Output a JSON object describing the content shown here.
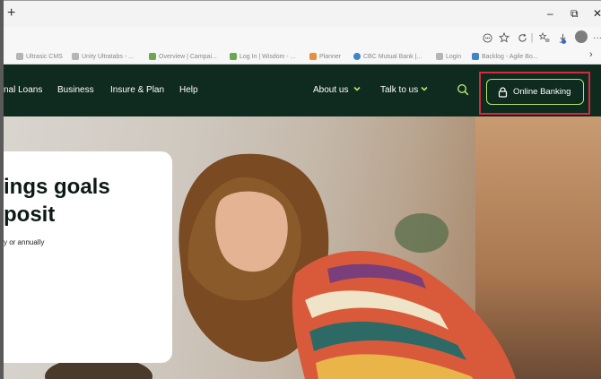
{
  "browser": {
    "new_tab_glyph": "+",
    "window_controls": {
      "minimize": "–",
      "restore": "⧉",
      "close": "✕"
    },
    "toolbar_icons": [
      "reader-icon",
      "favorite-star-icon",
      "refresh-icon",
      "favorites-list-icon",
      "downloads-icon",
      "profile-avatar-icon",
      "more-icon"
    ],
    "bookmarks": [
      {
        "label": "Ultrasic CMS",
        "color": "#9aa0a6"
      },
      {
        "label": "Unity Ultratabs - ...",
        "color": "#9aa0a6"
      },
      {
        "label": "Overview | Campai...",
        "color": "#6aa84f"
      },
      {
        "label": "Log In | Wisdom - ...",
        "color": "#6aa84f"
      },
      {
        "label": "Planner",
        "color": "#e69138"
      },
      {
        "label": "CBC Mutual Bank |...",
        "color": "#3d85c6"
      },
      {
        "label": "Login",
        "color": "#9aa0a6"
      },
      {
        "label": "Backlog - Agile Bo...",
        "color": "#3d85c6"
      }
    ],
    "bookmarks_overflow": "›"
  },
  "nav": {
    "items": [
      {
        "label": "nal Loans",
        "dropdown": false
      },
      {
        "label": "Business",
        "dropdown": false
      },
      {
        "label": "Insure & Plan",
        "dropdown": false
      },
      {
        "label": "Help",
        "dropdown": false
      },
      {
        "label": "About us",
        "dropdown": true
      },
      {
        "label": "Talk to us",
        "dropdown": true
      }
    ],
    "online_banking_label": "Online Banking"
  },
  "hero": {
    "title_line1": "ings goals",
    "title_line2": "posit",
    "subtitle": "y or annually"
  },
  "colors": {
    "nav_bg": "#0f2a1f",
    "accent_lime": "#b6e46a",
    "highlight_red": "#d32b3a"
  }
}
